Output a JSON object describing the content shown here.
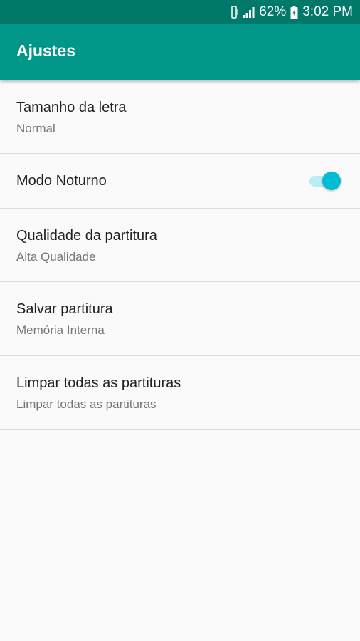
{
  "status_bar": {
    "battery": "62%",
    "time": "3:02 PM",
    "icons": [
      "vibrate-icon",
      "signal-icon",
      "battery-charging-icon"
    ]
  },
  "app_bar": {
    "title": "Ajustes"
  },
  "settings": {
    "font_size": {
      "title": "Tamanho da letra",
      "summary": "Normal"
    },
    "night_mode": {
      "title": "Modo Noturno",
      "enabled": true
    },
    "score_quality": {
      "title": "Qualidade da partitura",
      "summary": "Alta Qualidade"
    },
    "save_score": {
      "title": "Salvar partitura",
      "summary": "Memória Interna"
    },
    "clear_scores": {
      "title": "Limpar todas as partituras",
      "summary": "Limpar todas as partituras"
    }
  },
  "colors": {
    "status_bar": "#00796b",
    "app_bar": "#009688",
    "toggle_accent": "#00bcd4",
    "background": "#fafafa"
  }
}
